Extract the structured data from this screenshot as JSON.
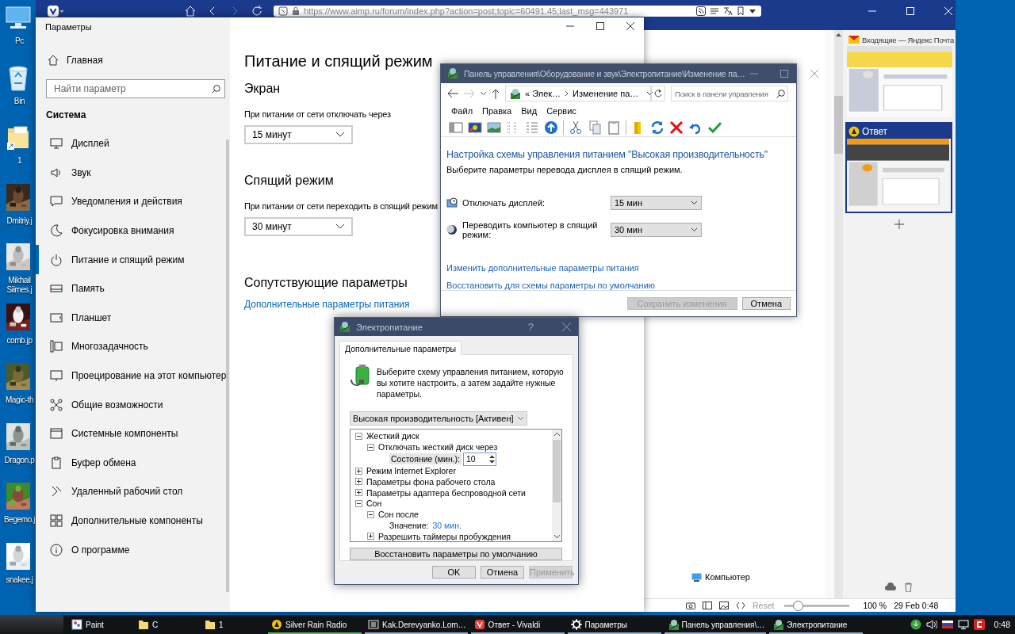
{
  "desktop": {
    "icons": [
      {
        "label": "Pc",
        "kind": "computer"
      },
      {
        "label": "Bin",
        "kind": "recycle"
      },
      {
        "label": "1",
        "kind": "folder"
      },
      {
        "label": "Dmitriy.j",
        "kind": "picture"
      },
      {
        "label": "Mikhail Siimes.j",
        "kind": "picture"
      },
      {
        "label": "comb.jp",
        "kind": "picture"
      },
      {
        "label": "Magic-th",
        "kind": "picture"
      },
      {
        "label": "Dragon.p",
        "kind": "picture"
      },
      {
        "label": "Begemo.j",
        "kind": "picture"
      },
      {
        "label": "snakee.j",
        "kind": "picture"
      }
    ]
  },
  "browser": {
    "url": "https://www.aimp.ru/forum/index.php?action=post;topic=60491.45;last_msg=443971",
    "side_tabs": [
      {
        "title": "Входящие — Яндекс Почта",
        "selected": false
      },
      {
        "title": "Ответ",
        "selected": true
      }
    ],
    "page_status": "Компьютер",
    "status_bar": {
      "reset": "Reset",
      "zoom": {
        "level": 0.2
      },
      "zoom_text": "100 %",
      "datetime": "29 Feb 0:48"
    }
  },
  "settings": {
    "title": "Параметры",
    "home": "Главная",
    "search": {
      "placeholder": "Найти параметр"
    },
    "section": "Система",
    "nav": [
      {
        "label": "Дисплей",
        "selected": false
      },
      {
        "label": "Звук",
        "selected": false
      },
      {
        "label": "Уведомления и действия",
        "selected": false
      },
      {
        "label": "Фокусировка внимания",
        "selected": false
      },
      {
        "label": "Питание и спящий режим",
        "selected": true
      },
      {
        "label": "Память",
        "selected": false
      },
      {
        "label": "Планшет",
        "selected": false
      },
      {
        "label": "Многозадачность",
        "selected": false
      },
      {
        "label": "Проецирование на этот компьютер",
        "selected": false
      },
      {
        "label": "Общие возможности",
        "selected": false
      },
      {
        "label": "Системные компоненты",
        "selected": false
      },
      {
        "label": "Буфер обмена",
        "selected": false
      },
      {
        "label": "Удаленный рабочий стол",
        "selected": false
      },
      {
        "label": "Дополнительные компоненты",
        "selected": false
      },
      {
        "label": "О программе",
        "selected": false
      }
    ],
    "heading": "Питание и спящий режим",
    "groups": [
      {
        "title": "Экран",
        "label": "При питании от сети отключать через",
        "value": "15 минут"
      },
      {
        "title": "Спящий режим",
        "label": "При питании от сети переходить в спящий режим",
        "value": "30 минут"
      }
    ],
    "related_title": "Сопутствующие параметры",
    "related_link": "Дополнительные параметры питания"
  },
  "control_panel": {
    "title": "Панель управления\\Оборудование и звук\\Электропитание\\Изменение па…",
    "breadcrumb": [
      "« Элек…",
      "Изменение па…"
    ],
    "search": {
      "placeholder": "Поиск в панели управления"
    },
    "menu": [
      "Файл",
      "Правка",
      "Вид",
      "Сервис"
    ],
    "heading": "Настройка схемы управления питанием \"Высокая производительность\"",
    "subtitle": "Выберите параметры перевода дисплея в спящий режим.",
    "settings": [
      {
        "kind": "display",
        "label": "Отключать дисплей:",
        "value": "15 мин"
      },
      {
        "kind": "sleep",
        "label": "Переводить компьютер в спящий режим:",
        "value": "30 мин"
      }
    ],
    "links": [
      "Изменить дополнительные параметры питания",
      "Восстановить для схемы параметры по умолчанию"
    ],
    "buttons": [
      {
        "label": "Сохранить изменения",
        "disabled": true
      },
      {
        "label": "Отмена",
        "disabled": false
      }
    ]
  },
  "power_dialog": {
    "title": "Электропитание",
    "help": "?",
    "tab": "Дополнительные параметры",
    "intro": "Выберите схему управления питанием, которую вы хотите настроить, а затем задайте нужные параметры.",
    "plan": "Высокая производительность [Активен]",
    "tree": [
      {
        "kind": "group",
        "label": "Жесткий диск",
        "expanded": true,
        "children": [
          {
            "kind": "group",
            "label": "Отключать жесткий диск через",
            "expanded": true,
            "children": [
              {
                "kind": "field",
                "label": "Состояние (мин.):",
                "value": "10"
              }
            ]
          }
        ]
      },
      {
        "kind": "group",
        "label": "Режим Internet Explorer",
        "expanded": false
      },
      {
        "kind": "group",
        "label": "Параметры фона рабочего стола",
        "expanded": false
      },
      {
        "kind": "group",
        "label": "Параметры адаптера беспроводной сети",
        "expanded": false
      },
      {
        "kind": "group",
        "label": "Сон",
        "expanded": true,
        "children": [
          {
            "kind": "group",
            "label": "Сон после",
            "expanded": true,
            "children": [
              {
                "kind": "value",
                "label": "Значение:",
                "value": "30 мин."
              }
            ]
          },
          {
            "kind": "group",
            "label": "Разрешить таймеры пробуждения",
            "expanded": false
          }
        ]
      }
    ],
    "restore": "Восстановить параметры по умолчанию",
    "buttons": [
      {
        "label": "OK",
        "disabled": false
      },
      {
        "label": "Отмена",
        "disabled": false
      },
      {
        "label": "Применить",
        "disabled": true
      }
    ]
  },
  "taskbar": {
    "items": [
      {
        "kind": "paint",
        "label": "Paint",
        "open": false
      },
      {
        "kind": "folder",
        "label": "C",
        "open": false
      },
      {
        "kind": "folder",
        "label": "1",
        "open": false
      },
      {
        "kind": "radio",
        "label": "Silver Rain Radio",
        "open": true,
        "color": "#5cb85c"
      },
      {
        "kind": "video",
        "label": "Kak.Derevyanko.Lom…",
        "open": true,
        "color": "#8fb4d8"
      },
      {
        "kind": "browser",
        "label": "Ответ - Vivaldi",
        "open": true,
        "color": "#8fb4d8"
      },
      {
        "kind": "settings",
        "label": "Параметры",
        "open": true,
        "color": "#8fb4d8"
      },
      {
        "kind": "panel",
        "label": "Панель управления\\…",
        "open": true,
        "color": "#8fb4d8"
      },
      {
        "kind": "power",
        "label": "Электропитание",
        "open": true,
        "color": "#8fb4d8"
      }
    ],
    "clock": "0:48"
  }
}
